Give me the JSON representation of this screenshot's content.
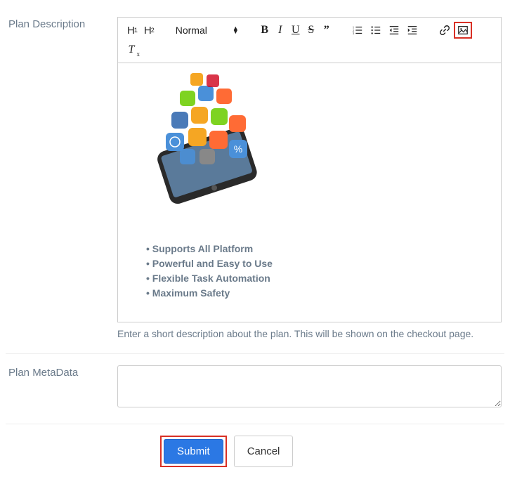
{
  "labels": {
    "plan_description": "Plan Description",
    "plan_metadata": "Plan MetaData"
  },
  "toolbar": {
    "size_label": "Normal"
  },
  "editor": {
    "bullets": [
      "Supports All Platform",
      "Powerful and Easy to Use",
      "Flexible Task Automation",
      "Maximum Safety"
    ]
  },
  "help": {
    "description": "Enter a short description about the plan. This will be shown on the checkout page."
  },
  "metadata": {
    "value": ""
  },
  "buttons": {
    "submit": "Submit",
    "cancel": "Cancel"
  }
}
